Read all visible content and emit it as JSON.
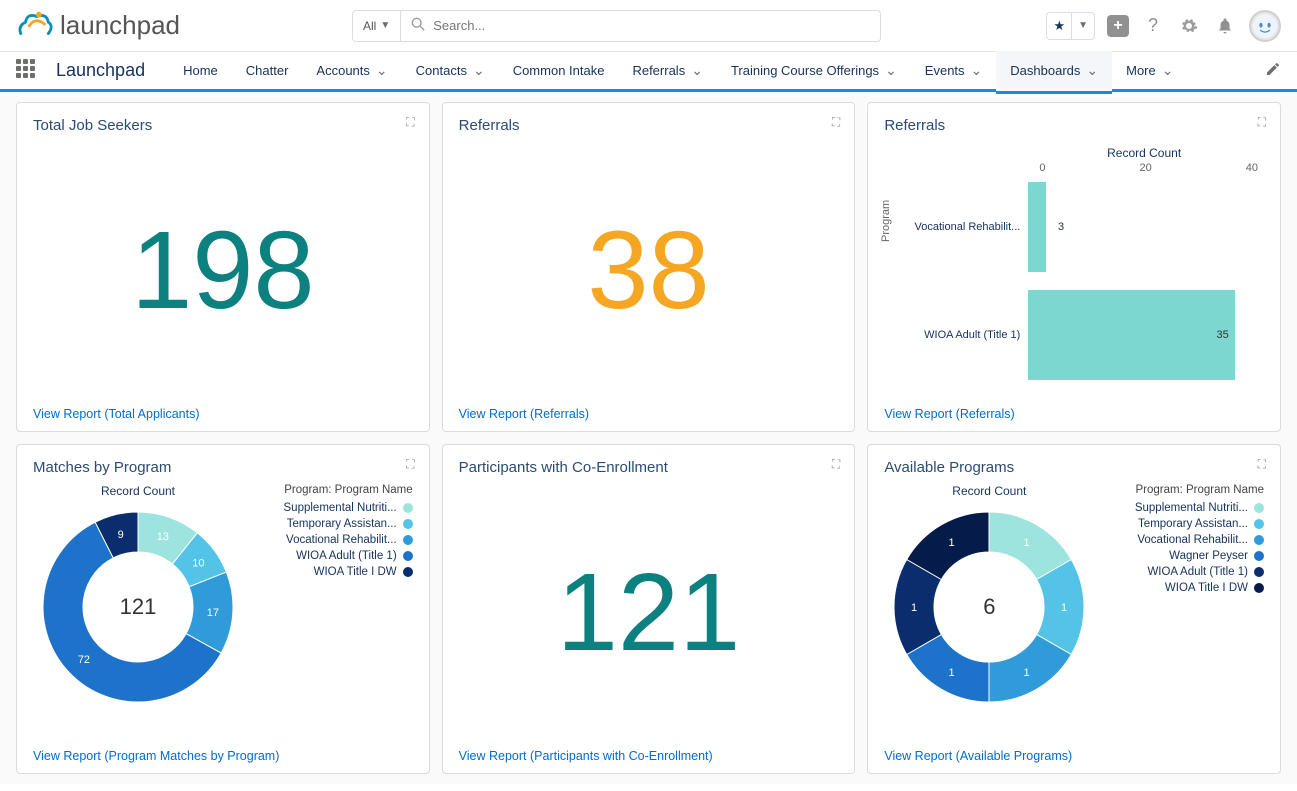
{
  "brand": {
    "name": "launchpad"
  },
  "search": {
    "scope": "All",
    "placeholder": "Search..."
  },
  "appName": "Launchpad",
  "nav": {
    "items": [
      {
        "label": "Home",
        "dropdown": false
      },
      {
        "label": "Chatter",
        "dropdown": false
      },
      {
        "label": "Accounts",
        "dropdown": true
      },
      {
        "label": "Contacts",
        "dropdown": true
      },
      {
        "label": "Common Intake",
        "dropdown": false
      },
      {
        "label": "Referrals",
        "dropdown": true
      },
      {
        "label": "Training Course Offerings",
        "dropdown": true
      },
      {
        "label": "Events",
        "dropdown": true
      },
      {
        "label": "Dashboards",
        "dropdown": true,
        "active": true
      },
      {
        "label": "More",
        "dropdown": true
      }
    ]
  },
  "cards": {
    "jobSeekers": {
      "title": "Total Job Seekers",
      "value": "198",
      "report": "View Report (Total Applicants)"
    },
    "referralsCount": {
      "title": "Referrals",
      "value": "38",
      "report": "View Report (Referrals)"
    },
    "referralsBar": {
      "title": "Referrals",
      "axisTitle": "Record Count",
      "yAxisLabel": "Program",
      "ticks": [
        "0",
        "20",
        "40"
      ],
      "report": "View Report (Referrals)"
    },
    "matches": {
      "title": "Matches by Program",
      "subtitle": "Record Count",
      "legendTitle": "Program: Program Name",
      "total": "121",
      "report": "View Report (Program Matches by Program)"
    },
    "coEnroll": {
      "title": "Participants with Co-Enrollment",
      "value": "121",
      "report": "View Report (Participants with Co-Enrollment)"
    },
    "available": {
      "title": "Available Programs",
      "subtitle": "Record Count",
      "legendTitle": "Program: Program Name",
      "total": "6",
      "report": "View Report (Available Programs)"
    }
  },
  "chart_data": [
    {
      "id": "referralsBar",
      "type": "bar",
      "orientation": "horizontal",
      "title": "Record Count",
      "ylabel": "Program",
      "xlim": [
        0,
        40
      ],
      "categories": [
        "Vocational Rehabilit...",
        "WIOA Adult (Title 1)"
      ],
      "values": [
        3,
        35
      ],
      "color": "#7bd7cf"
    },
    {
      "id": "matches",
      "type": "donut",
      "title": "Record Count",
      "total": 121,
      "legend_title": "Program: Program Name",
      "series": [
        {
          "name": "Supplemental Nutriti...",
          "value": 13,
          "color": "#9de3de"
        },
        {
          "name": "Temporary Assistan...",
          "value": 10,
          "color": "#53c4e8"
        },
        {
          "name": "Vocational Rehabilit...",
          "value": 17,
          "color": "#2f9bd8"
        },
        {
          "name": "WIOA Adult (Title 1)",
          "value": 72,
          "color": "#1d73c9"
        },
        {
          "name": "WIOA Title I DW",
          "value": 9,
          "color": "#0a2d6e"
        }
      ]
    },
    {
      "id": "available",
      "type": "donut",
      "title": "Record Count",
      "total": 6,
      "legend_title": "Program: Program Name",
      "series": [
        {
          "name": "Supplemental Nutriti...",
          "value": 1,
          "color": "#9de3de"
        },
        {
          "name": "Temporary Assistan...",
          "value": 1,
          "color": "#53c4e8"
        },
        {
          "name": "Vocational Rehabilit...",
          "value": 1,
          "color": "#2f9bd8"
        },
        {
          "name": "Wagner Peyser",
          "value": 1,
          "color": "#1d73c9"
        },
        {
          "name": "WIOA Adult (Title 1)",
          "value": 1,
          "color": "#0a2d6e"
        },
        {
          "name": "WIOA Title I DW",
          "value": 1,
          "color": "#051c4a"
        }
      ]
    }
  ]
}
